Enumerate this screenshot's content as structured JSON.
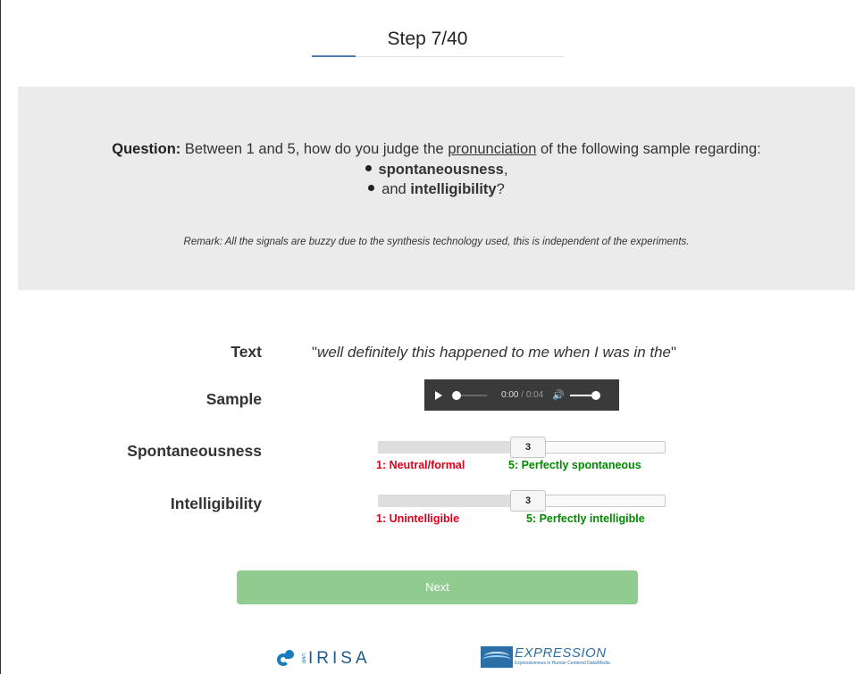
{
  "header": {
    "step_label": "Step 7/40",
    "progress_fraction": 0.175
  },
  "question": {
    "prefix": "Question:",
    "text_before": " Between 1 and 5, how do you judge the ",
    "underlined": "pronunciation",
    "text_after": " of the following sample regarding:",
    "bullet1_bold": "spontaneousness",
    "bullet1_suffix": ",",
    "bullet2_prefix": "and ",
    "bullet2_bold": "intelligibility",
    "bullet2_suffix": "?",
    "remark": "Remark: All the signals are buzzy due to the synthesis technology used, this is independent of the experiments."
  },
  "form": {
    "text_label": "Text",
    "text_value_open": "\"",
    "text_value": "well definitely this happened to me when I was in the",
    "text_value_close": "\"",
    "sample_label": "Sample",
    "audio": {
      "current_time": "0:00",
      "separator": " / ",
      "duration": "0:04",
      "volume_level": 1.0,
      "position_fraction": 0.0
    },
    "spontaneousness": {
      "label": "Spontaneousness",
      "value": "3",
      "value_fraction": 0.5,
      "min_label": "1: Neutral/formal",
      "max_label": "5: Perfectly spontaneous"
    },
    "intelligibility": {
      "label": "Intelligibility",
      "value": "3",
      "value_fraction": 0.5,
      "min_label": "1: Unintelligible",
      "max_label": "5: Perfectly intelligible"
    },
    "next_label": "Next"
  },
  "footer": {
    "irisa_tiny": "UMR",
    "irisa_name": "IRISA",
    "expression_name": "EXPRESSION",
    "expression_tagline": "Expressiveness in Human Centered Data/Media"
  },
  "colors": {
    "panel_bg": "#ebebeb",
    "next_button": "#90cc90",
    "min_label": "#e0001a",
    "max_label": "#008a00",
    "progress": "#4a7bb0"
  }
}
